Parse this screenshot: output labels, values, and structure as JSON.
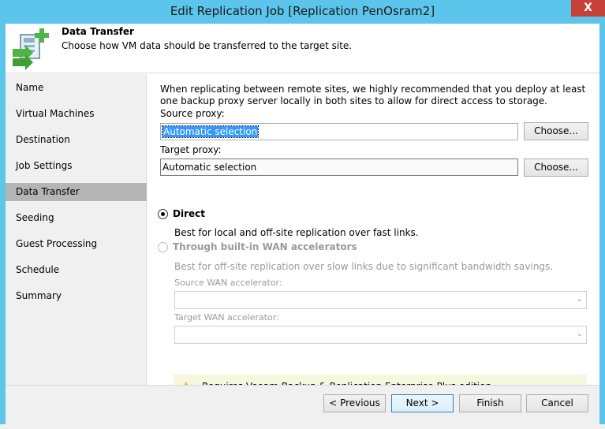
{
  "window": {
    "title": "Edit Replication Job [Replication PenOsram2]",
    "close_label": "X"
  },
  "header": {
    "title": "Data Transfer",
    "subtitle": "Choose how VM data should be transferred to the target site."
  },
  "sidebar": {
    "items": [
      {
        "label": "Name",
        "active": false
      },
      {
        "label": "Virtual Machines",
        "active": false
      },
      {
        "label": "Destination",
        "active": false
      },
      {
        "label": "Job Settings",
        "active": false
      },
      {
        "label": "Data Transfer",
        "active": true
      },
      {
        "label": "Seeding",
        "active": false
      },
      {
        "label": "Guest Processing",
        "active": false
      },
      {
        "label": "Schedule",
        "active": false
      },
      {
        "label": "Summary",
        "active": false
      }
    ]
  },
  "main": {
    "info": "When replicating between remote sites, we highly recommended that you deploy at least one backup proxy server locally in both sites to allow for direct access to storage.",
    "source_proxy": {
      "label": "Source proxy:",
      "value": "Automatic selection",
      "button": "Choose..."
    },
    "target_proxy": {
      "label": "Target proxy:",
      "value": "Automatic selection",
      "button": "Choose..."
    },
    "direct": {
      "label": "Direct",
      "description": "Best for local and off-site replication over fast links.",
      "checked": true
    },
    "wan": {
      "label": "Through built-in WAN accelerators",
      "description": "Best for off-site replication over slow links due to significant bandwidth savings.",
      "source_label": "Source WAN accelerator:",
      "target_label": "Target WAN accelerator:",
      "checked": false
    },
    "warning": "Requires Veeam Backup & Replication Enterprise Plus edition."
  },
  "footer": {
    "previous": "< Previous",
    "next": "Next >",
    "finish": "Finish",
    "cancel": "Cancel"
  },
  "colors": {
    "title_bar": "#5cc5eb",
    "close": "#c7403a",
    "active_nav": "#b5b5b5",
    "selection": "#3399ff",
    "warning_bg": "#f5f8dc"
  },
  "icons": [
    "data-transfer-icon",
    "close-icon",
    "warning-icon",
    "chevron-down-icon"
  ]
}
